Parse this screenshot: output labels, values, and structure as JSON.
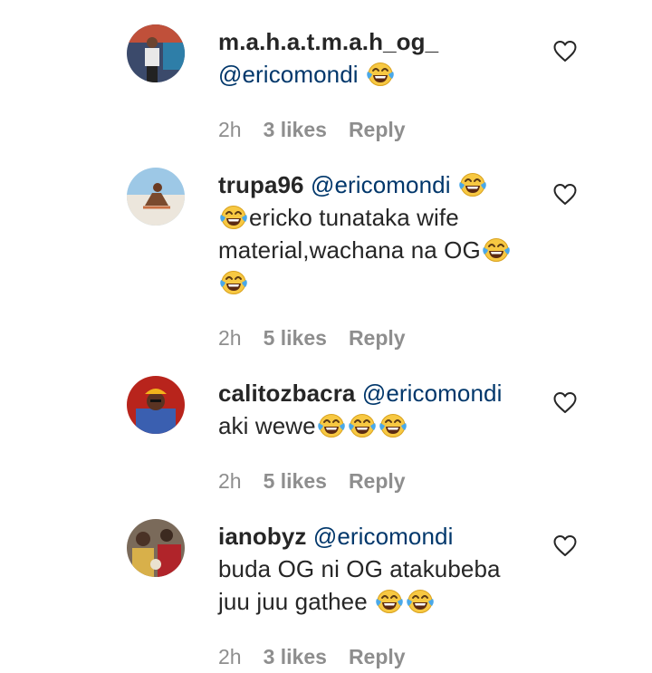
{
  "comments": [
    {
      "username": "m.a.h.a.t.m.a.h_og_",
      "mention": "@ericomondi",
      "time": "2h",
      "likes": "3 likes",
      "reply": "Reply"
    },
    {
      "username": "trupa96",
      "mention": "@ericomondi",
      "text_a": "ericko tunataka wife",
      "text_b": "material,wachana na OG",
      "time": "2h",
      "likes": "5 likes",
      "reply": "Reply"
    },
    {
      "username": "calitozbacra",
      "mention": "@ericomondi",
      "text_a": "aki wewe",
      "time": "2h",
      "likes": "5 likes",
      "reply": "Reply"
    },
    {
      "username": "ianobyz",
      "mention": "@ericomondi",
      "text_a": "buda OG ni OG atakubeba",
      "text_b": "juu juu gathee",
      "time": "2h",
      "likes": "3 likes",
      "reply": "Reply"
    }
  ],
  "icons": {
    "like": "heart-outline-icon",
    "emoji": "face-with-tears-of-joy"
  },
  "colors": {
    "username": "#262626",
    "mention": "#00376b",
    "meta": "#8e8e8e",
    "emoji_face": "#f7c842"
  }
}
